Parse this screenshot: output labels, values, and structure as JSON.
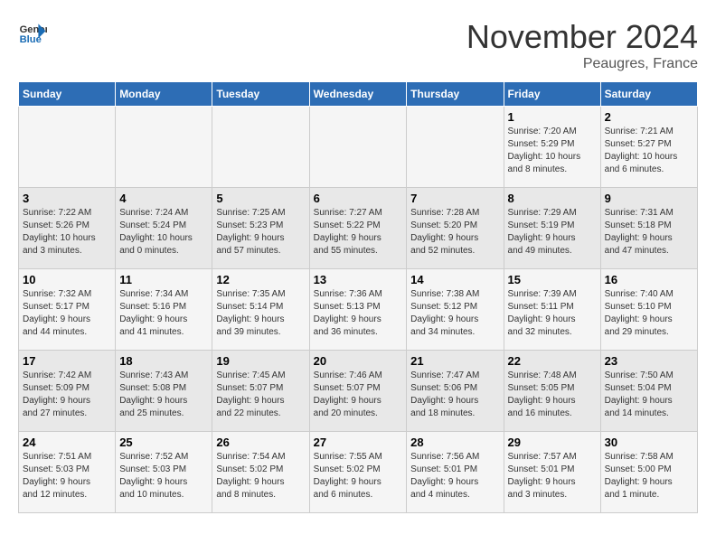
{
  "header": {
    "logo_line1": "General",
    "logo_line2": "Blue",
    "month": "November 2024",
    "location": "Peaugres, France"
  },
  "weekdays": [
    "Sunday",
    "Monday",
    "Tuesday",
    "Wednesday",
    "Thursday",
    "Friday",
    "Saturday"
  ],
  "weeks": [
    [
      {
        "day": "",
        "info": ""
      },
      {
        "day": "",
        "info": ""
      },
      {
        "day": "",
        "info": ""
      },
      {
        "day": "",
        "info": ""
      },
      {
        "day": "",
        "info": ""
      },
      {
        "day": "1",
        "info": "Sunrise: 7:20 AM\nSunset: 5:29 PM\nDaylight: 10 hours\nand 8 minutes."
      },
      {
        "day": "2",
        "info": "Sunrise: 7:21 AM\nSunset: 5:27 PM\nDaylight: 10 hours\nand 6 minutes."
      }
    ],
    [
      {
        "day": "3",
        "info": "Sunrise: 7:22 AM\nSunset: 5:26 PM\nDaylight: 10 hours\nand 3 minutes."
      },
      {
        "day": "4",
        "info": "Sunrise: 7:24 AM\nSunset: 5:24 PM\nDaylight: 10 hours\nand 0 minutes."
      },
      {
        "day": "5",
        "info": "Sunrise: 7:25 AM\nSunset: 5:23 PM\nDaylight: 9 hours\nand 57 minutes."
      },
      {
        "day": "6",
        "info": "Sunrise: 7:27 AM\nSunset: 5:22 PM\nDaylight: 9 hours\nand 55 minutes."
      },
      {
        "day": "7",
        "info": "Sunrise: 7:28 AM\nSunset: 5:20 PM\nDaylight: 9 hours\nand 52 minutes."
      },
      {
        "day": "8",
        "info": "Sunrise: 7:29 AM\nSunset: 5:19 PM\nDaylight: 9 hours\nand 49 minutes."
      },
      {
        "day": "9",
        "info": "Sunrise: 7:31 AM\nSunset: 5:18 PM\nDaylight: 9 hours\nand 47 minutes."
      }
    ],
    [
      {
        "day": "10",
        "info": "Sunrise: 7:32 AM\nSunset: 5:17 PM\nDaylight: 9 hours\nand 44 minutes."
      },
      {
        "day": "11",
        "info": "Sunrise: 7:34 AM\nSunset: 5:16 PM\nDaylight: 9 hours\nand 41 minutes."
      },
      {
        "day": "12",
        "info": "Sunrise: 7:35 AM\nSunset: 5:14 PM\nDaylight: 9 hours\nand 39 minutes."
      },
      {
        "day": "13",
        "info": "Sunrise: 7:36 AM\nSunset: 5:13 PM\nDaylight: 9 hours\nand 36 minutes."
      },
      {
        "day": "14",
        "info": "Sunrise: 7:38 AM\nSunset: 5:12 PM\nDaylight: 9 hours\nand 34 minutes."
      },
      {
        "day": "15",
        "info": "Sunrise: 7:39 AM\nSunset: 5:11 PM\nDaylight: 9 hours\nand 32 minutes."
      },
      {
        "day": "16",
        "info": "Sunrise: 7:40 AM\nSunset: 5:10 PM\nDaylight: 9 hours\nand 29 minutes."
      }
    ],
    [
      {
        "day": "17",
        "info": "Sunrise: 7:42 AM\nSunset: 5:09 PM\nDaylight: 9 hours\nand 27 minutes."
      },
      {
        "day": "18",
        "info": "Sunrise: 7:43 AM\nSunset: 5:08 PM\nDaylight: 9 hours\nand 25 minutes."
      },
      {
        "day": "19",
        "info": "Sunrise: 7:45 AM\nSunset: 5:07 PM\nDaylight: 9 hours\nand 22 minutes."
      },
      {
        "day": "20",
        "info": "Sunrise: 7:46 AM\nSunset: 5:07 PM\nDaylight: 9 hours\nand 20 minutes."
      },
      {
        "day": "21",
        "info": "Sunrise: 7:47 AM\nSunset: 5:06 PM\nDaylight: 9 hours\nand 18 minutes."
      },
      {
        "day": "22",
        "info": "Sunrise: 7:48 AM\nSunset: 5:05 PM\nDaylight: 9 hours\nand 16 minutes."
      },
      {
        "day": "23",
        "info": "Sunrise: 7:50 AM\nSunset: 5:04 PM\nDaylight: 9 hours\nand 14 minutes."
      }
    ],
    [
      {
        "day": "24",
        "info": "Sunrise: 7:51 AM\nSunset: 5:03 PM\nDaylight: 9 hours\nand 12 minutes."
      },
      {
        "day": "25",
        "info": "Sunrise: 7:52 AM\nSunset: 5:03 PM\nDaylight: 9 hours\nand 10 minutes."
      },
      {
        "day": "26",
        "info": "Sunrise: 7:54 AM\nSunset: 5:02 PM\nDaylight: 9 hours\nand 8 minutes."
      },
      {
        "day": "27",
        "info": "Sunrise: 7:55 AM\nSunset: 5:02 PM\nDaylight: 9 hours\nand 6 minutes."
      },
      {
        "day": "28",
        "info": "Sunrise: 7:56 AM\nSunset: 5:01 PM\nDaylight: 9 hours\nand 4 minutes."
      },
      {
        "day": "29",
        "info": "Sunrise: 7:57 AM\nSunset: 5:01 PM\nDaylight: 9 hours\nand 3 minutes."
      },
      {
        "day": "30",
        "info": "Sunrise: 7:58 AM\nSunset: 5:00 PM\nDaylight: 9 hours\nand 1 minute."
      }
    ]
  ]
}
